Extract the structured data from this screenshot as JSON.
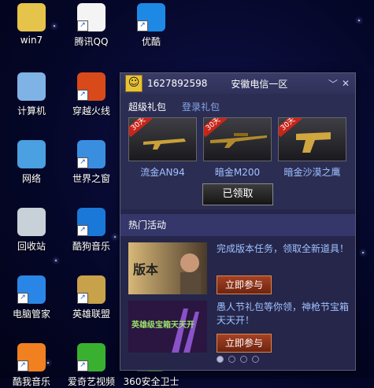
{
  "desktop": {
    "icons": [
      {
        "label": "win7",
        "icon": "folder-icon"
      },
      {
        "label": "腾讯QQ",
        "icon": "qq-icon"
      },
      {
        "label": "优酷",
        "icon": "youku-icon"
      },
      {
        "label": "计算机",
        "icon": "computer-icon"
      },
      {
        "label": "穿越火线",
        "icon": "crossfire-icon"
      },
      {
        "label": "网络",
        "icon": "network-icon"
      },
      {
        "label": "世界之窗",
        "icon": "theworld-browser-icon"
      },
      {
        "label": "回收站",
        "icon": "recycle-bin-icon"
      },
      {
        "label": "酷狗音乐",
        "icon": "kugou-icon"
      },
      {
        "label": "电脑管家",
        "icon": "pc-manager-icon"
      },
      {
        "label": "英雄联盟",
        "icon": "lol-icon"
      },
      {
        "label": "酷我音乐",
        "icon": "kuwo-icon"
      },
      {
        "label": "爱奇艺视频",
        "icon": "iqiyi-icon"
      },
      {
        "label": "360安全卫士",
        "icon": "360-icon"
      }
    ]
  },
  "panel": {
    "qq_number": "1627892598",
    "region": "安徽电信一区",
    "tabs": {
      "super_gift": "超级礼包",
      "login_gift": "登录礼包"
    },
    "gift_badge": "30天",
    "gifts": [
      {
        "name": "流金AN94",
        "color": "#c9a13a"
      },
      {
        "name": "暗金M200",
        "color": "#b08a2c"
      },
      {
        "name": "暗金沙漠之鹰",
        "color": "#d0a640"
      }
    ],
    "claim_label": "已领取",
    "hot_title": "热门活动",
    "activities": [
      {
        "text": "完成版本任务，领取全新道具！",
        "button": "立即参与",
        "banner_text": "版本",
        "color": "#c6a45a"
      },
      {
        "text": "愚人节礼包等你领，神枪节宝箱天天开！",
        "button": "立即参与",
        "banner_text": "英雄级宝箱天天开",
        "color": "#7a3fb0"
      }
    ],
    "pager_count": 4
  }
}
